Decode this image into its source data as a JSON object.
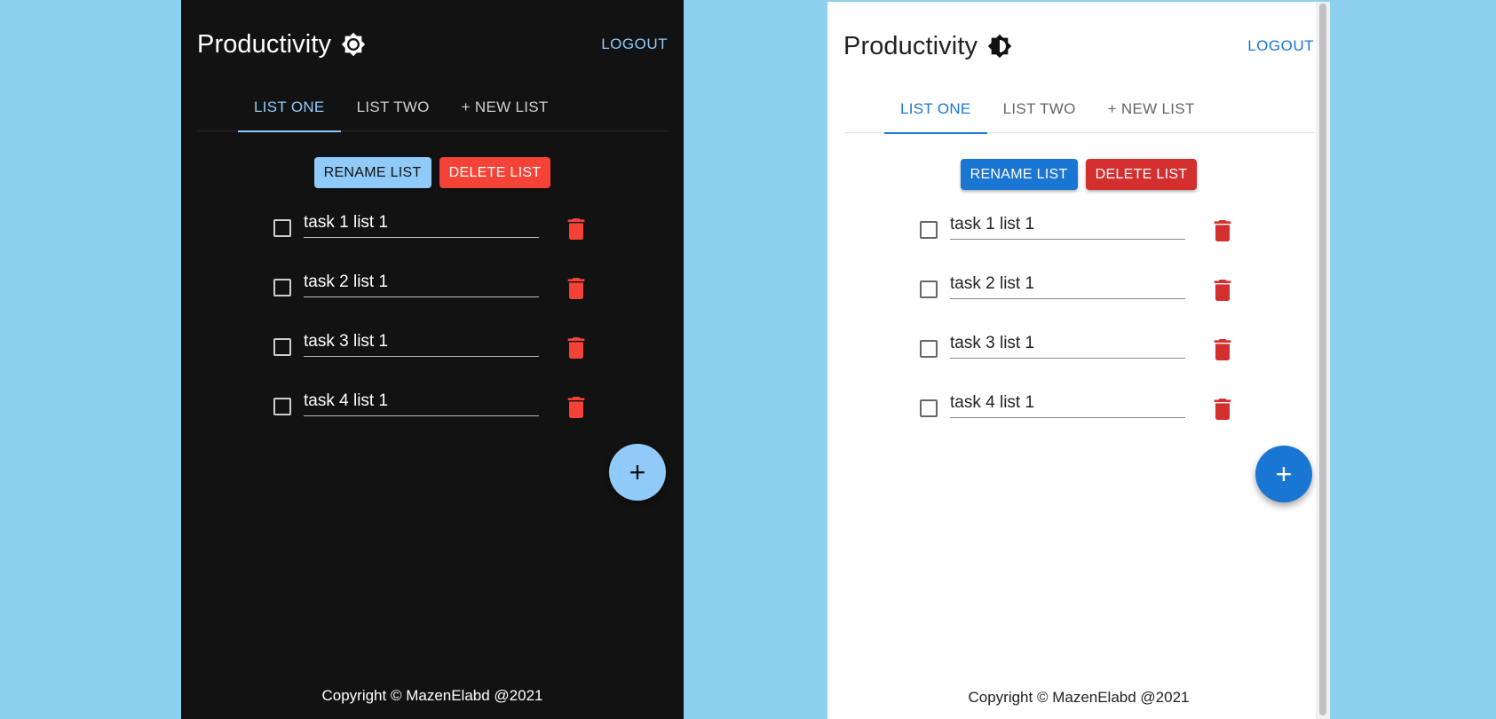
{
  "colors": {
    "page_background": "#8ed1ef",
    "dark_panel": "#121212",
    "light_panel": "#ffffff",
    "dark_accent": "#90caf9",
    "light_accent": "#1976d2",
    "danger_dark": "#f44336",
    "danger_light": "#d32f2f"
  },
  "dark": {
    "header": {
      "title": "Productivity",
      "theme_icon": "brightness-high-icon",
      "logout_label": "LOGOUT"
    },
    "tabs": [
      {
        "label": "LIST ONE",
        "active": true
      },
      {
        "label": "LIST TWO",
        "active": false
      },
      {
        "label": "+ NEW LIST",
        "active": false
      }
    ],
    "actions": {
      "rename_label": "RENAME LIST",
      "delete_label": "DELETE LIST"
    },
    "tasks": [
      {
        "text": "task 1 list 1",
        "checked": false
      },
      {
        "text": "task 2 list 1",
        "checked": false
      },
      {
        "text": "task 3 list 1",
        "checked": false
      },
      {
        "text": "task 4 list 1",
        "checked": false
      }
    ],
    "fab_label": "+",
    "footer": "Copyright © MazenElabd @2021"
  },
  "light": {
    "header": {
      "title": "Productivity",
      "theme_icon": "brightness-half-icon",
      "logout_label": "LOGOUT"
    },
    "tabs": [
      {
        "label": "LIST ONE",
        "active": true
      },
      {
        "label": "LIST TWO",
        "active": false
      },
      {
        "label": "+ NEW LIST",
        "active": false
      }
    ],
    "actions": {
      "rename_label": "RENAME LIST",
      "delete_label": "DELETE LIST"
    },
    "tasks": [
      {
        "text": "task 1 list 1",
        "checked": false
      },
      {
        "text": "task 2 list 1",
        "checked": false
      },
      {
        "text": "task 3 list 1",
        "checked": false
      },
      {
        "text": "task 4 list 1",
        "checked": false
      }
    ],
    "fab_label": "+",
    "footer": "Copyright © MazenElabd @2021"
  }
}
